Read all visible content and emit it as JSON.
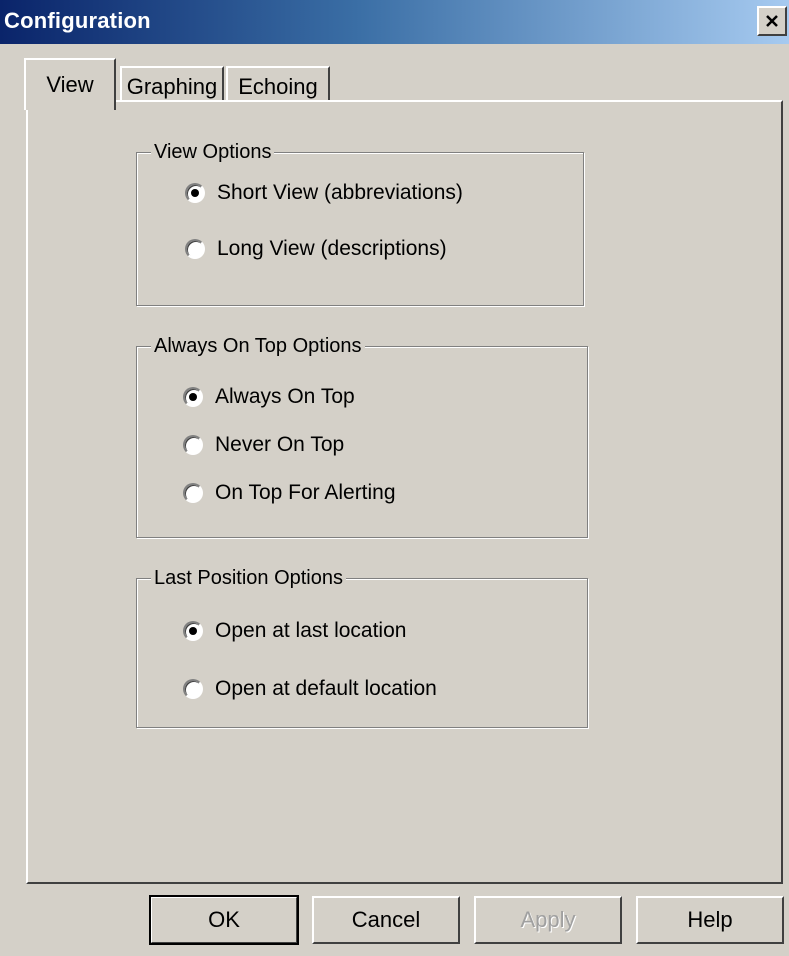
{
  "window": {
    "title": "Configuration",
    "close_icon": "close-icon",
    "title_bar_colors": [
      "#0a246a",
      "#a6caf0"
    ]
  },
  "tabs": [
    {
      "label": "View",
      "active": true
    },
    {
      "label": "Graphing",
      "active": false
    },
    {
      "label": "Echoing",
      "active": false
    }
  ],
  "groups": {
    "view_options": {
      "title": "View Options",
      "options": [
        {
          "label": "Short View (abbreviations)",
          "selected": true
        },
        {
          "label": "Long View (descriptions)",
          "selected": false
        }
      ]
    },
    "on_top_options": {
      "title": "Always On Top Options",
      "options": [
        {
          "label": "Always On Top",
          "selected": true
        },
        {
          "label": "Never On Top",
          "selected": false
        },
        {
          "label": "On Top For Alerting",
          "selected": false
        }
      ]
    },
    "position_options": {
      "title": "Last Position Options",
      "options": [
        {
          "label": "Open at last location",
          "selected": true
        },
        {
          "label": "Open at default location",
          "selected": false
        }
      ]
    }
  },
  "buttons": {
    "ok": "OK",
    "cancel": "Cancel",
    "apply": "Apply",
    "help": "Help"
  }
}
